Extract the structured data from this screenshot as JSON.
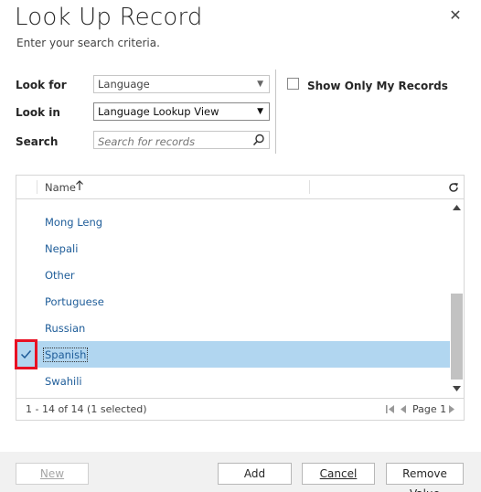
{
  "dialog": {
    "title": "Look Up Record",
    "subtitle": "Enter your search criteria.",
    "close_glyph": "✕"
  },
  "criteria": {
    "look_for_label": "Look for",
    "look_for_value": "Language",
    "look_in_label": "Look in",
    "look_in_value": "Language Lookup View",
    "search_label": "Search",
    "search_placeholder": "Search for records",
    "show_only_my_records_label": "Show Only My Records",
    "show_only_my_records_checked": false
  },
  "grid": {
    "column_name": "Name",
    "sort": "ascending",
    "rows": [
      {
        "name": "Mong Leng",
        "selected": false
      },
      {
        "name": "Nepali",
        "selected": false
      },
      {
        "name": "Other",
        "selected": false
      },
      {
        "name": "Portuguese",
        "selected": false
      },
      {
        "name": "Russian",
        "selected": false
      },
      {
        "name": "Spanish",
        "selected": true
      },
      {
        "name": "Swahili",
        "selected": false
      }
    ],
    "footer_count": "1 - 14 of 14 (1 selected)",
    "page_label": "Page 1",
    "colors": {
      "selected_row": "#b1d6f0",
      "link": "#1f5d99",
      "highlight": "#e81123"
    }
  },
  "buttons": {
    "new": "New",
    "add": "Add",
    "cancel": "Cancel",
    "remove_value": "Remove Value"
  },
  "icons": [
    "close-icon",
    "dropdown-arrow-icon",
    "search-icon",
    "sort-ascending-icon",
    "refresh-icon",
    "checkmark-icon",
    "scroll-up-icon",
    "scroll-down-icon",
    "first-page-icon",
    "previous-page-icon",
    "next-page-icon"
  ]
}
